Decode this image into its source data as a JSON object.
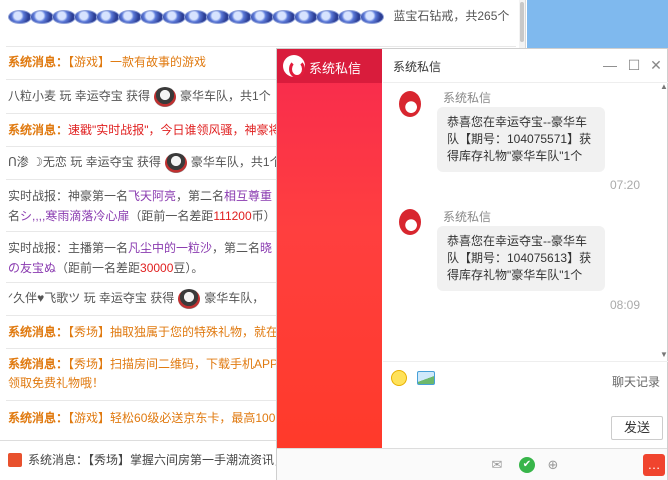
{
  "bg": {
    "row0": {
      "text": "蓝宝石钻戒，共265个"
    },
    "row1": {
      "prefix": "系统消息：",
      "text": "【游戏】一款有故事的游戏"
    },
    "row2": {
      "user": "八粒小麦",
      "mid": "玩 幸运夺宝 获得",
      "gift": "豪华车队，共1个"
    },
    "row3": {
      "prefix": "系统消息：",
      "text": "速戳\"实时战报\"，今日谁领风骚，神豪将"
    },
    "row4": {
      "user": "ᑎ渗 ☽无恋",
      "mid": "玩 幸运夺宝 获得",
      "gift": "豪华车队，共1个"
    },
    "row5a": {
      "label": "实时战报：神豪第一名",
      "name1": "飞天阿亮",
      "mid": "，第二名",
      "name2": "相互尊重"
    },
    "row5b": {
      "pre": "名",
      "name3": "シ,,,,寒雨滴落冷心扉",
      "tail1": "（距前一名差距",
      "num": "111200",
      "tail2": "币）"
    },
    "row6a": {
      "label": "实时战报：主播第一名",
      "name1": "凡尘中的一粒沙",
      "mid": "，第二名",
      "name2": "晓"
    },
    "row6b": {
      "name3": "の友宝ぬ",
      "tail1": "（距前一名差距",
      "num": "30000",
      "tail2": "豆）。"
    },
    "row7": {
      "user": "ᐟ久伴♥飞歌ツ",
      "mid": "玩 幸运夺宝 获得",
      "gift": "豪华车队，"
    },
    "row8": {
      "prefix": "系统消息：",
      "text": "【秀场】抽取独属于您的特殊礼物，就在"
    },
    "row9a": {
      "prefix": "系统消息：",
      "text": "【秀场】扫描房间二维码，下载手机APP"
    },
    "row9b": {
      "text": "领取免费礼物哦！"
    },
    "row10": {
      "prefix": "系统消息：",
      "text": "【游戏】轻松60级必送京东卡，最高100"
    },
    "footer": {
      "prefix": "系统消息：",
      "text": "【秀场】掌握六间房第一手潮流资讯，尽在\"广场\"！！"
    }
  },
  "pm": {
    "sidebar_title": "系统私信",
    "header_title": "系统私信",
    "messages": [
      {
        "sender": "系统私信",
        "text": "恭喜您在幸运夺宝--豪华车队【期号：104075571】获得库存礼物\"豪华车队\"1个",
        "time": "07:20"
      },
      {
        "sender": "系统私信",
        "text": "恭喜您在幸运夺宝--豪华车队【期号：104075613】获得库存礼物\"豪华车队\"1个",
        "time": "08:09"
      }
    ],
    "history_label": "聊天记录",
    "send_label": "发送"
  },
  "colors": {
    "accent": "#ff3a3a",
    "system_text": "#e07a10",
    "highlight": "#e02020"
  }
}
